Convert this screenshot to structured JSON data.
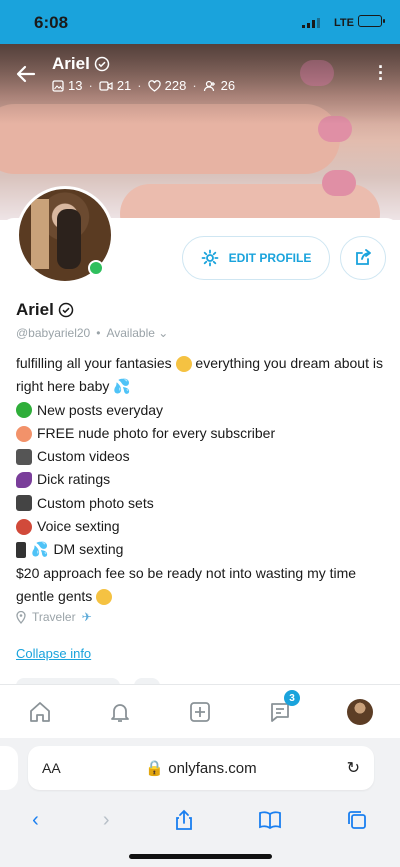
{
  "status_bar": {
    "time": "6:08",
    "network": "LTE"
  },
  "cover": {
    "name": "Ariel",
    "stats": [
      {
        "icon": "image-icon",
        "value": "13"
      },
      {
        "icon": "video-icon",
        "value": "21"
      },
      {
        "icon": "heart-icon",
        "value": "228"
      },
      {
        "icon": "fans-icon",
        "value": "26"
      }
    ]
  },
  "profile": {
    "edit_label": "EDIT PROFILE",
    "name": "Ariel",
    "handle": "@babyariel20",
    "separator": "•",
    "availability": "Available",
    "bio": [
      "fulfilling all your fantasies",
      "everything you dream about is right here baby",
      "New posts everyday",
      "FREE nude photo for every subscriber",
      "Custom videos",
      "Dick ratings",
      "Custom photo sets",
      "Voice sexting",
      "DM sexting",
      "$20 approach fee so be ready not into wasting my time gentle gents"
    ],
    "location": "Traveler",
    "collapse_label": "Collapse info"
  },
  "tabbar": {
    "messages_badge": "3"
  },
  "browser": {
    "aa_label": "AA",
    "url": "onlyfans.com"
  },
  "colors": {
    "accent": "#1aa3dc",
    "online": "#2fbf5d"
  }
}
